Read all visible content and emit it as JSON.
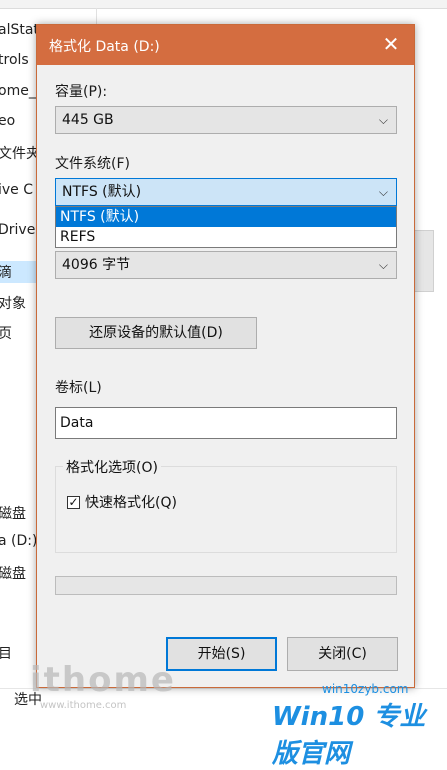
{
  "background": {
    "items": [
      "alStat",
      "trols",
      "ome_",
      "eo",
      "文件夹",
      "ive C",
      "Drive",
      "滴",
      "对象",
      "页",
      "",
      "",
      "",
      "",
      "",
      "磁盘",
      "a (D:)",
      "磁盘",
      "",
      "目",
      "选中"
    ],
    "watermark_left": "ithome",
    "watermark_left_url": "www.ithome.com",
    "watermark_right": "Win10 专业版官网",
    "watermark_right_url": "win10zyb.com"
  },
  "dialog": {
    "title": "格式化 Data (D:)",
    "close_glyph": "✕",
    "capacity_label": "容量(P):",
    "capacity_value": "445 GB",
    "filesystem_label": "文件系统(F)",
    "filesystem_value": "NTFS (默认)",
    "filesystem_options": [
      "NTFS (默认)",
      "REFS"
    ],
    "filesystem_selected_index": 0,
    "allocation_value": "4096 字节",
    "restore_defaults_label": "还原设备的默认值(D)",
    "volume_label_label": "卷标(L)",
    "volume_label_value": "Data",
    "format_options_label": "格式化选项(O)",
    "quick_format_label": "快速格式化(Q)",
    "quick_format_checked": true,
    "progress": 0,
    "start_label": "开始(S)",
    "close_label": "关闭(C)",
    "chevron_glyph": "⌵",
    "accent_color": "#d46d40",
    "selection_color": "#0078d7"
  }
}
